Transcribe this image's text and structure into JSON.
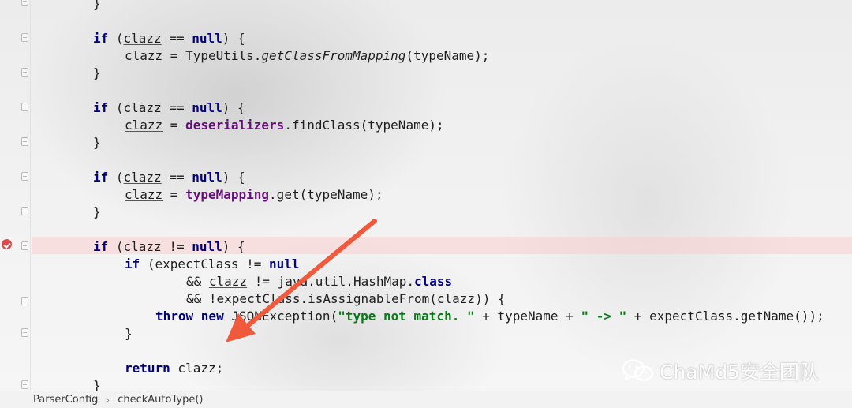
{
  "code": {
    "lines": [
      [
        {
          "t": "}",
          "c": ""
        }
      ],
      [
        {
          "t": "if",
          "c": "kw"
        },
        {
          "t": " (",
          "c": ""
        },
        {
          "t": "clazz",
          "c": "ul"
        },
        {
          "t": " == ",
          "c": ""
        },
        {
          "t": "null",
          "c": "kw"
        },
        {
          "t": ") {",
          "c": ""
        }
      ],
      [
        {
          "t": "clazz",
          "c": "ul"
        },
        {
          "t": " = TypeUtils.",
          "c": ""
        },
        {
          "t": "getClassFromMapping",
          "c": "it"
        },
        {
          "t": "(typeName);",
          "c": ""
        }
      ],
      [
        {
          "t": "}",
          "c": ""
        }
      ],
      [
        {
          "t": "if",
          "c": "kw"
        },
        {
          "t": " (",
          "c": ""
        },
        {
          "t": "clazz",
          "c": "ul"
        },
        {
          "t": " == ",
          "c": ""
        },
        {
          "t": "null",
          "c": "kw"
        },
        {
          "t": ") {",
          "c": ""
        }
      ],
      [
        {
          "t": "clazz",
          "c": "ul"
        },
        {
          "t": " = ",
          "c": ""
        },
        {
          "t": "deserializers",
          "c": "fld"
        },
        {
          "t": ".findClass(typeName);",
          "c": ""
        }
      ],
      [
        {
          "t": "}",
          "c": ""
        }
      ],
      [
        {
          "t": "if",
          "c": "kw"
        },
        {
          "t": " (",
          "c": ""
        },
        {
          "t": "clazz",
          "c": "ul"
        },
        {
          "t": " == ",
          "c": ""
        },
        {
          "t": "null",
          "c": "kw"
        },
        {
          "t": ") {",
          "c": ""
        }
      ],
      [
        {
          "t": "clazz",
          "c": "ul"
        },
        {
          "t": " = ",
          "c": ""
        },
        {
          "t": "typeMapping",
          "c": "fld"
        },
        {
          "t": ".get(typeName);",
          "c": ""
        }
      ],
      [
        {
          "t": "}",
          "c": ""
        }
      ],
      [
        {
          "t": "if",
          "c": "kw"
        },
        {
          "t": " (",
          "c": ""
        },
        {
          "t": "clazz",
          "c": "ul"
        },
        {
          "t": " != ",
          "c": ""
        },
        {
          "t": "null",
          "c": "kw"
        },
        {
          "t": ") {",
          "c": ""
        }
      ],
      [
        {
          "t": "if",
          "c": "kw"
        },
        {
          "t": " (expectClass != ",
          "c": ""
        },
        {
          "t": "null",
          "c": "kw"
        }
      ],
      [
        {
          "t": "&& ",
          "c": ""
        },
        {
          "t": "clazz",
          "c": "ul"
        },
        {
          "t": " != java.util.HashMap.",
          "c": ""
        },
        {
          "t": "class",
          "c": "kw"
        }
      ],
      [
        {
          "t": "&& !expectClass.isAssignableFrom(",
          "c": ""
        },
        {
          "t": "clazz",
          "c": "ul"
        },
        {
          "t": ")) {",
          "c": ""
        }
      ],
      [
        {
          "t": "throw new",
          "c": "kw"
        },
        {
          "t": " JSONException(",
          "c": ""
        },
        {
          "t": "\"type not match. \"",
          "c": "str"
        },
        {
          "t": " + typeName + ",
          "c": ""
        },
        {
          "t": "\" -> \"",
          "c": "str"
        },
        {
          "t": " + expectClass.getName());",
          "c": ""
        }
      ],
      [
        {
          "t": "}",
          "c": ""
        }
      ],
      [
        {
          "t": "return",
          "c": "kw"
        },
        {
          "t": " clazz;",
          "c": ""
        }
      ],
      [
        {
          "t": "}",
          "c": ""
        }
      ]
    ]
  },
  "breadcrumb": {
    "items": [
      "ParserConfig",
      "checkAutoType()"
    ]
  },
  "watermark": {
    "text": "ChaMd5安全团队"
  },
  "colors": {
    "keyword": "#000080",
    "field": "#660e7a",
    "string": "#067d17",
    "arrow": "#f05a3c",
    "breakpoint": "#d94a4a",
    "highlight_row": "#fad2d2"
  }
}
